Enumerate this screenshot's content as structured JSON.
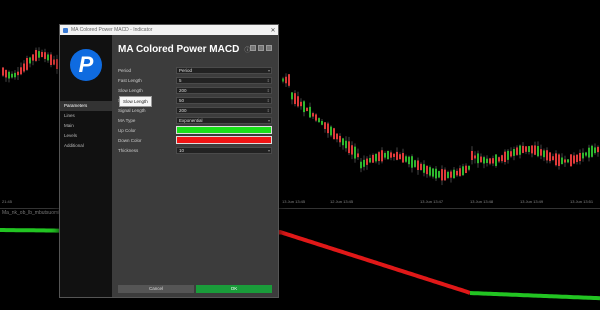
{
  "chart": {
    "time_labels": [
      "21:45",
      "13 Jun 13:45",
      "12 Jun 13:45",
      "13 Jun 13:47",
      "13 Jun 13:48",
      "13 Jun 13:49",
      "13 Jun 13:51"
    ],
    "indicator_label": "Ma_nk_ob_lb_mbutsuomis ...   ...   ...",
    "colors": {
      "up": "#2eb82e",
      "down": "#e03a3a",
      "line_green": "#22c422",
      "line_red": "#e01818"
    }
  },
  "dialog": {
    "window_title": "MA Colored Power MACD - Indicator",
    "close_glyph": "✕",
    "logo_letter": "P",
    "title": "MA Colored Power MACD",
    "info_glyph": "ⓘ",
    "nav": [
      "Parameters",
      "Lines",
      "Main",
      "Levels",
      "Additional"
    ],
    "props": [
      {
        "label": "Period",
        "value": "Period",
        "spin": "▾"
      },
      {
        "label": "Fast Length",
        "value": "5",
        "spin": "⇕"
      },
      {
        "label": "Slow Length",
        "value": "200",
        "spin": "⇕"
      },
      {
        "label": "Signal Length",
        "value": "50",
        "spin": "⇕"
      },
      {
        "label": "Signal Length",
        "value": "200",
        "spin": "⇕"
      },
      {
        "label": "MA Type",
        "value": "Exponential",
        "spin": "▾"
      }
    ],
    "colors": [
      {
        "label": "Up Color",
        "value": "#19e019"
      },
      {
        "label": "Down Color",
        "value": "#f01414"
      }
    ],
    "thickness": {
      "label": "Thickness",
      "value": "10",
      "spin": "▾"
    },
    "tooltip": "Slow Length",
    "cancel_label": "Cancel",
    "ok_label": "OK"
  }
}
